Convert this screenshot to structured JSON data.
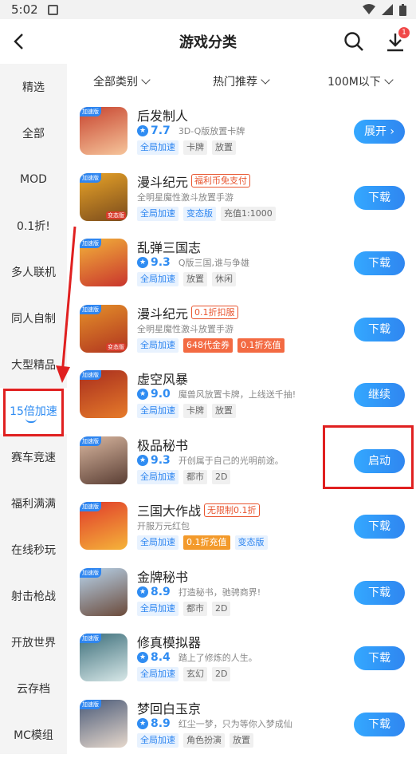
{
  "status": {
    "time": "5:02"
  },
  "header": {
    "title": "游戏分类",
    "download_badge": "1"
  },
  "sidebar": [
    {
      "label": "精选"
    },
    {
      "label": "全部"
    },
    {
      "label": "MOD"
    },
    {
      "label": "0.1折!"
    },
    {
      "label": "多人联机"
    },
    {
      "label": "同人自制"
    },
    {
      "label": "大型精品"
    },
    {
      "label": "15倍加速",
      "active": true
    },
    {
      "label": "赛车竞速"
    },
    {
      "label": "福利满满"
    },
    {
      "label": "在线秒玩"
    },
    {
      "label": "射击枪战"
    },
    {
      "label": "开放世界"
    },
    {
      "label": "云存档"
    },
    {
      "label": "MC模组"
    }
  ],
  "filters": {
    "category": "全部类别",
    "sort": "热门推荐",
    "size": "100M以下"
  },
  "games": [
    {
      "name": "后发制人",
      "promo": "",
      "rating": "7.7",
      "desc": "3D-Q版放置卡牌",
      "tags": [
        {
          "text": "全局加速",
          "style": "blue"
        },
        {
          "text": "卡牌"
        },
        {
          "text": "放置"
        }
      ],
      "button": "展开",
      "icon_colors": [
        "#c7442f",
        "#f6c59b"
      ]
    },
    {
      "name": "漫斗纪元",
      "promo": "福利币免支付",
      "rating": "",
      "desc": "全明星魔性激斗放置手游",
      "tags": [
        {
          "text": "全局加速",
          "style": "blue"
        },
        {
          "text": "变态版",
          "style": "blue"
        },
        {
          "text": "充值1:1000"
        }
      ],
      "button": "下载",
      "icon_colors": [
        "#e9a428",
        "#7a4b1c"
      ]
    },
    {
      "name": "乱弹三国志",
      "promo": "",
      "rating": "9.3",
      "desc": "Q版三国,谁与争雄",
      "tags": [
        {
          "text": "全局加速",
          "style": "blue"
        },
        {
          "text": "放置"
        },
        {
          "text": "休闲"
        }
      ],
      "button": "下载",
      "icon_colors": [
        "#f2b23a",
        "#c9352d"
      ]
    },
    {
      "name": "漫斗纪元",
      "promo": "0.1折扣服",
      "rating": "",
      "desc": "全明星魔性激斗放置手游",
      "tags": [
        {
          "text": "全局加速",
          "style": "blue"
        },
        {
          "text": "648代金券",
          "style": "red"
        },
        {
          "text": "0.1折充值",
          "style": "red"
        }
      ],
      "button": "下载",
      "icon_colors": [
        "#e5912a",
        "#b0341f"
      ]
    },
    {
      "name": "虚空风暴",
      "promo": "",
      "rating": "9.0",
      "desc": "魔兽风放置卡牌，上线送千抽!",
      "tags": [
        {
          "text": "全局加速",
          "style": "blue"
        },
        {
          "text": "卡牌"
        },
        {
          "text": "放置"
        }
      ],
      "button": "继续",
      "icon_colors": [
        "#a82d1e",
        "#e67b2a"
      ]
    },
    {
      "name": "极品秘书",
      "promo": "",
      "rating": "9.3",
      "desc": "开创属于自己的光明前途。",
      "tags": [
        {
          "text": "全局加速",
          "style": "blue"
        },
        {
          "text": "都市"
        },
        {
          "text": "2D"
        }
      ],
      "button": "启动",
      "icon_colors": [
        "#d9b7a0",
        "#5a3e34"
      ]
    },
    {
      "name": "三国大作战",
      "promo": "无限制0.1折",
      "rating": "",
      "desc": "开服万元红包",
      "tags": [
        {
          "text": "全局加速",
          "style": "blue"
        },
        {
          "text": "0.1折充值",
          "style": "orange"
        },
        {
          "text": "变态版",
          "style": "blue"
        }
      ],
      "button": "下载",
      "icon_colors": [
        "#e03a2a",
        "#f5b43a"
      ]
    },
    {
      "name": "金牌秘书",
      "promo": "",
      "rating": "8.9",
      "desc": "打造秘书，驰骋商界!",
      "tags": [
        {
          "text": "全局加速",
          "style": "blue"
        },
        {
          "text": "都市"
        },
        {
          "text": "2D"
        }
      ],
      "button": "下载",
      "icon_colors": [
        "#b8d4ec",
        "#6b4a3a"
      ]
    },
    {
      "name": "修真模拟器",
      "promo": "",
      "rating": "8.4",
      "desc": "踏上了修炼的人生。",
      "tags": [
        {
          "text": "全局加速",
          "style": "blue"
        },
        {
          "text": "玄幻"
        },
        {
          "text": "2D"
        }
      ],
      "button": "下载",
      "icon_colors": [
        "#3c6e7a",
        "#d8e8e8"
      ]
    },
    {
      "name": "梦回白玉京",
      "promo": "",
      "rating": "8.9",
      "desc": "红尘一梦，只为等你入梦成仙",
      "tags": [
        {
          "text": "全局加速",
          "style": "blue"
        },
        {
          "text": "角色扮演"
        },
        {
          "text": "放置"
        }
      ],
      "button": "下载",
      "icon_colors": [
        "#4a5a78",
        "#e6d8cc"
      ]
    }
  ],
  "accelerator_tag": "加速版",
  "icon_badges": {
    "1": "变态版",
    "3": "变态版"
  }
}
